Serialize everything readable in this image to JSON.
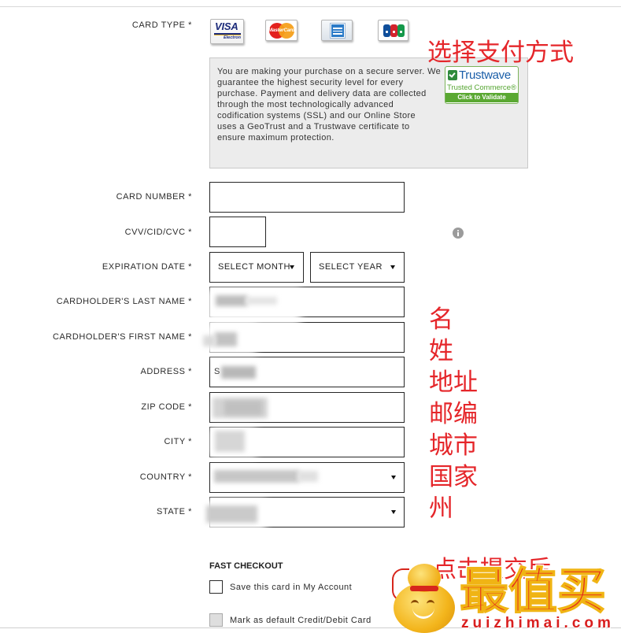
{
  "form": {
    "card_type": {
      "label": "CARD TYPE *",
      "visa": {
        "brand": "VISA",
        "sub": "Electron",
        "icon": "visa-electron-icon"
      },
      "mastercard": {
        "brand": "MasterCard",
        "icon": "mastercard-icon"
      },
      "amex": {
        "icon": "american-express-icon"
      },
      "jcb": {
        "icon": "jcb-icon"
      }
    },
    "secure_notice": "You are making your purchase on a secure server. We\nguarantee the highest security level for every\npurchase. Payment and delivery data are collected\nthrough the most technologically advanced\ncodification systems (SSL) and our Online Store\nuses a GeoTrust and a Trustwave certificate to\nensure maximum protection.",
    "trustwave_seal": {
      "name": "Trustwave",
      "tagline": "Trusted Commerce®",
      "action": "Click to Validate"
    },
    "card_number": {
      "label": "CARD NUMBER *"
    },
    "cvv": {
      "label": "CVV/CID/CVC *",
      "help_icon": "info-icon"
    },
    "expiration_date": {
      "label": "EXPIRATION DATE *",
      "month": "SELECT MONTH",
      "year": "SELECT YEAR"
    },
    "last_name": {
      "label": "CARDHOLDER'S LAST NAME *"
    },
    "first_name": {
      "label": "CARDHOLDER'S FIRST NAME *"
    },
    "address": {
      "label": "ADDRESS *",
      "value": "S"
    },
    "zip_code": {
      "label": "ZIP CODE *"
    },
    "city": {
      "label": "CITY *"
    },
    "country": {
      "label": "COUNTRY *"
    },
    "state": {
      "label": "STATE *"
    }
  },
  "fast_checkout": {
    "title": "FAST CHECKOUT",
    "save_card": {
      "label": "Save this card in My Account",
      "checked": false
    },
    "default_card": {
      "label": "Mark as default Credit/Debit Card",
      "checked": false
    }
  },
  "annotations": {
    "choose_payment": "选择支付方式",
    "fields": [
      "名",
      "姓",
      "地址",
      "邮编",
      "城市",
      "国家",
      "州"
    ],
    "after_submit": "点击提交后"
  },
  "watermark": {
    "name": "最值买",
    "domain": "zuizhimai.com",
    "icon": "gourd-mascot-icon"
  },
  "colors": {
    "annotation_red": "#e5262a",
    "seal_green": "#5aa832",
    "field_border": "#262626",
    "notice_bg": "#ececec",
    "watermark_red": "#e3211b",
    "watermark_gold": "#f0b414"
  }
}
